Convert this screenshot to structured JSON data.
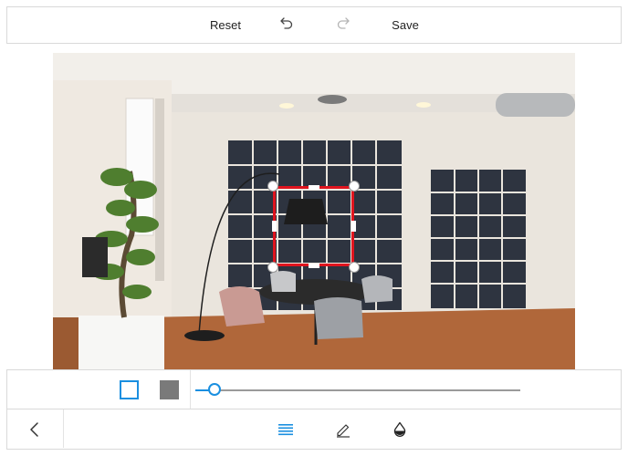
{
  "toolbar": {
    "reset_label": "Reset",
    "undo_icon": "undo-icon",
    "redo_icon": "redo-icon",
    "save_label": "Save"
  },
  "editor": {
    "image_description_icon": "office-room-photo",
    "crop_frame_color": "#e0141e"
  },
  "adjust_bar": {
    "outline_shape_icon": "square-outline-icon",
    "filled_shape_icon": "square-filled-icon",
    "slider_value_fraction": 0.06,
    "accent_color": "#1a8fe0"
  },
  "bottom_bar": {
    "back_icon": "chevron-left-icon",
    "tool_icons": [
      "lines-icon",
      "pen-icon",
      "fill-icon"
    ],
    "active_tool": "lines-icon"
  }
}
